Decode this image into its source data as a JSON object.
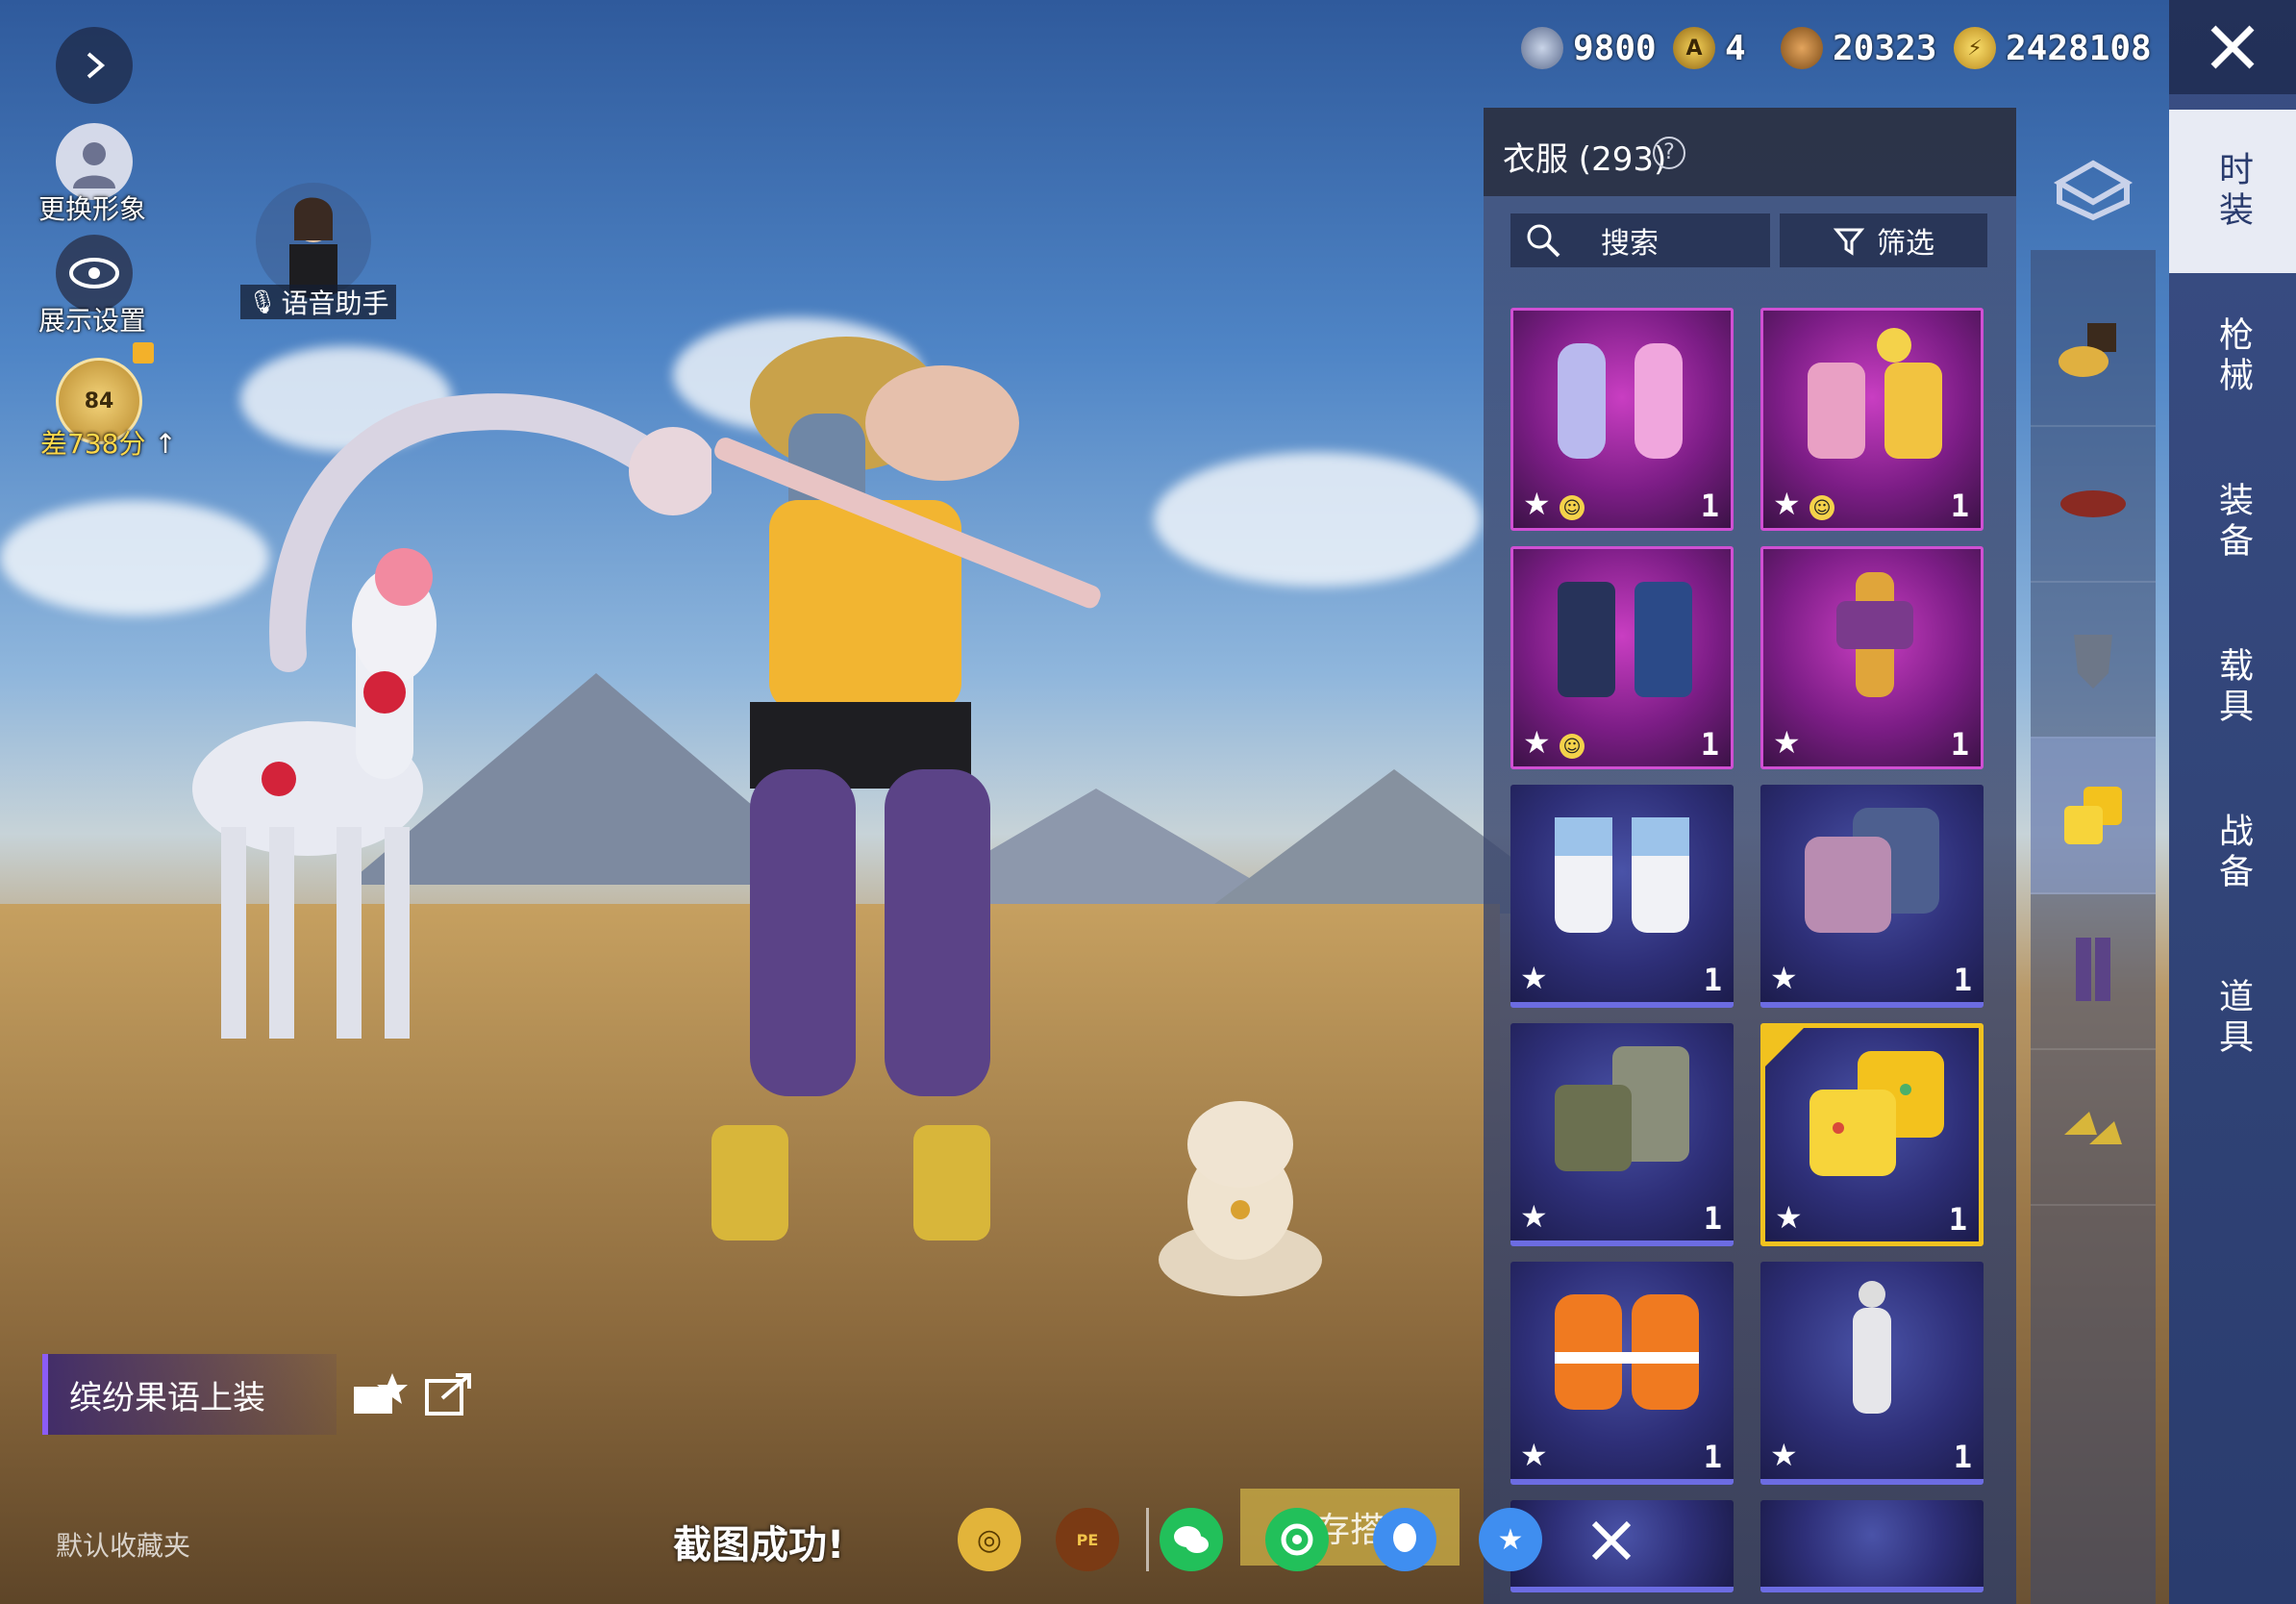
{
  "currency": [
    {
      "icon": "silver-coupon-icon",
      "value": "9800"
    },
    {
      "icon": "gold-medal-icon",
      "value": "4"
    },
    {
      "icon": "bp-coin-icon",
      "value": "20323"
    },
    {
      "icon": "energy-coin-icon",
      "value": "2428108"
    }
  ],
  "left": {
    "change_avatar": "更换形象",
    "display_settings": "展示设置",
    "voice_assistant": "语音助手",
    "rank_level": "84",
    "rank_gap": "差738分"
  },
  "outfit": {
    "name": "缤纷果语上装",
    "favorites": "默认收藏夹"
  },
  "wardrobe": {
    "title": "衣服 (293)",
    "search": "搜索",
    "filter": "筛选",
    "items": [
      {
        "icon": "lavender-bodysuit-outfit-icon",
        "count": "1",
        "rarity": "purple"
      },
      {
        "icon": "clown-costume-outfit-icon",
        "count": "1",
        "rarity": "purple"
      },
      {
        "icon": "dark-armor-outfit-icon",
        "count": "1",
        "rarity": "purple"
      },
      {
        "icon": "mecha-suit-outfit-icon",
        "count": "1",
        "rarity": "purple"
      },
      {
        "icon": "white-overalls-outfit-icon",
        "count": "1",
        "rarity": "blue"
      },
      {
        "icon": "pink-jacket-outfit-icon",
        "count": "1",
        "rarity": "blue"
      },
      {
        "icon": "green-scarf-vest-outfit-icon",
        "count": "1",
        "rarity": "blue"
      },
      {
        "icon": "fruit-shirt-outfit-icon",
        "count": "1",
        "rarity": "blue"
      },
      {
        "icon": "orange-hood-outfit-icon",
        "count": "1",
        "rarity": "blue"
      },
      {
        "icon": "white-bodysuit-outfit-icon",
        "count": "1",
        "rarity": "blue"
      }
    ]
  },
  "categories": [
    "hat-category-icon",
    "belt-category-icon",
    "mask-category-icon",
    "shirt-category-icon",
    "pants-category-icon",
    "shoes-category-icon"
  ],
  "tabs": [
    "时装",
    "枪械",
    "装备",
    "载具",
    "战备",
    "道具"
  ],
  "bottom": {
    "screenshot_msg": "截图成功!",
    "save_hint": "存搭"
  }
}
